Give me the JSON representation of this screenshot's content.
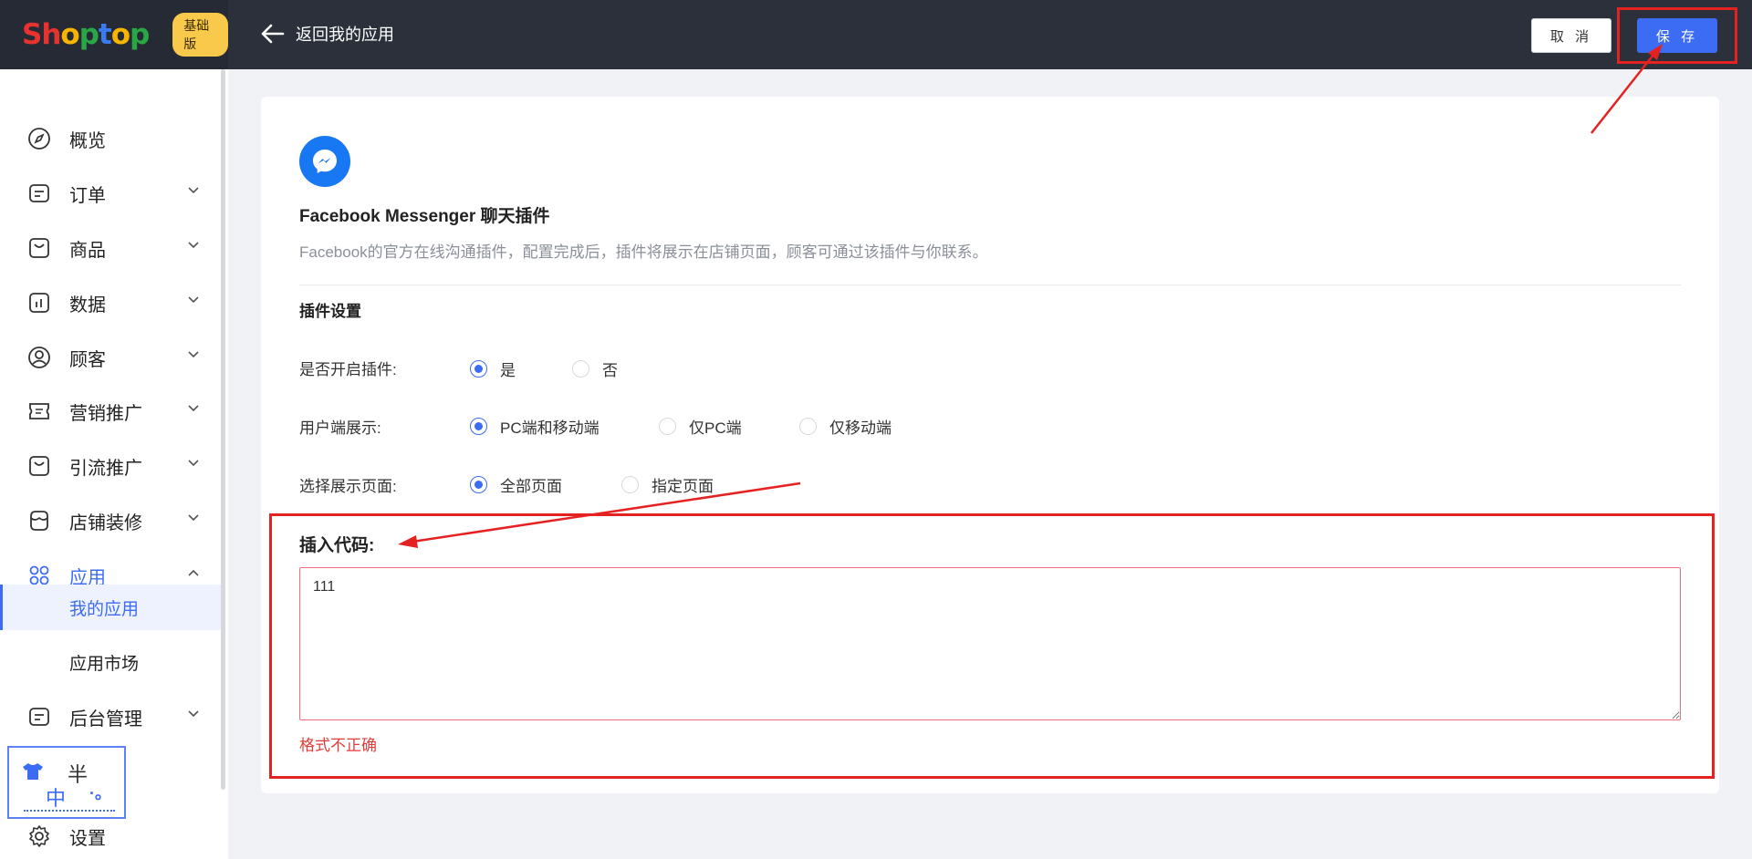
{
  "header": {
    "logo": "Shoptop",
    "edition": "基础版",
    "back_label": "返回我的应用",
    "cancel_label": "取 消",
    "save_label": "保 存"
  },
  "sidebar": {
    "items": [
      {
        "label": "概览",
        "icon": "compass-icon"
      },
      {
        "label": "订单",
        "icon": "order-icon"
      },
      {
        "label": "商品",
        "icon": "bag-icon"
      },
      {
        "label": "数据",
        "icon": "chart-icon"
      },
      {
        "label": "顾客",
        "icon": "user-icon"
      },
      {
        "label": "营销推广",
        "icon": "ticket-icon"
      },
      {
        "label": "引流推广",
        "icon": "bag-icon"
      },
      {
        "label": "店铺装修",
        "icon": "store-icon"
      },
      {
        "label": "应用",
        "icon": "apps-icon"
      }
    ],
    "sub_items": [
      "我的应用",
      "应用市场"
    ],
    "admin": "后台管理",
    "settings": "设置"
  },
  "ime": {
    "c1": "半",
    "c2": "中",
    "c3": "·。"
  },
  "plugin": {
    "title": "Facebook Messenger 聊天插件",
    "description": "Facebook的官方在线沟通插件，配置完成后，插件将展示在店铺页面，顾客可通过该插件与你联系。",
    "section_title": "插件设置",
    "enable_label": "是否开启插件:",
    "enable_options": [
      "是",
      "否"
    ],
    "display_label": "用户端展示:",
    "display_options": [
      "PC端和移动端",
      "仅PC端",
      "仅移动端"
    ],
    "page_label": "选择展示页面:",
    "page_options": [
      "全部页面",
      "指定页面"
    ],
    "code_label": "插入代码:",
    "code_value": "111",
    "error": "格式不正确"
  },
  "colors": {
    "accent": "#3d6cf4",
    "highlight": "#e52222",
    "header_bg": "#2b303b"
  }
}
